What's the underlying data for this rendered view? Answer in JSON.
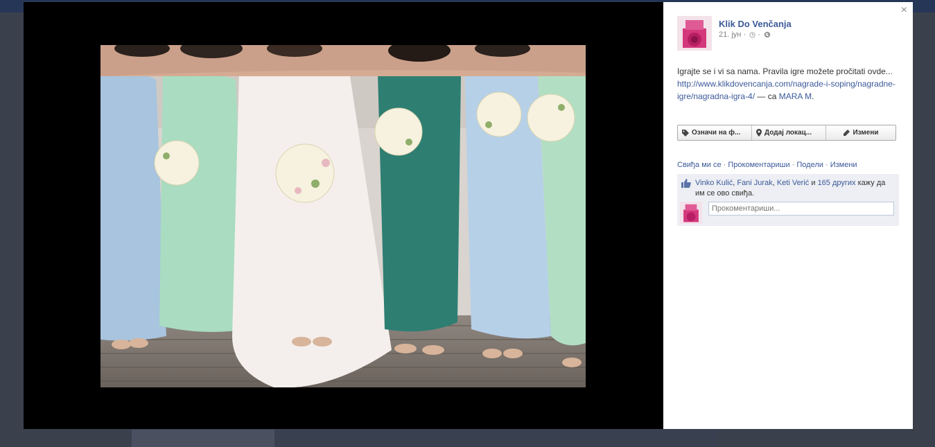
{
  "post": {
    "page_name": "Klik Do Venčanja",
    "date": "21. јун",
    "text_before": "Igrajte se i vi sa nama. Pravila igre možete pročitati ovde... ",
    "link": "http://www.klikdovencanja.com/nagrade-i-soping/nagradne-igre/nagradna-igra-4/",
    "with_text": " — са ",
    "with_person": "MARA M",
    "end": "."
  },
  "actions": {
    "tag": "Означи на ф...",
    "location": "Додај локац...",
    "edit": "Измени"
  },
  "links": {
    "like": "Свиђа ми се",
    "comment": "Прокоментариши",
    "share": "Подели",
    "edit": "Измени"
  },
  "likes": {
    "person1": "Vinko Kulić",
    "person2": "Fani Jurak",
    "person3": "Keti Verić",
    "and": " и ",
    "others": "165 других",
    "suffix": " кажу да им се ово свиђа."
  },
  "comment": {
    "placeholder": "Прокоментариши..."
  },
  "close": "×"
}
